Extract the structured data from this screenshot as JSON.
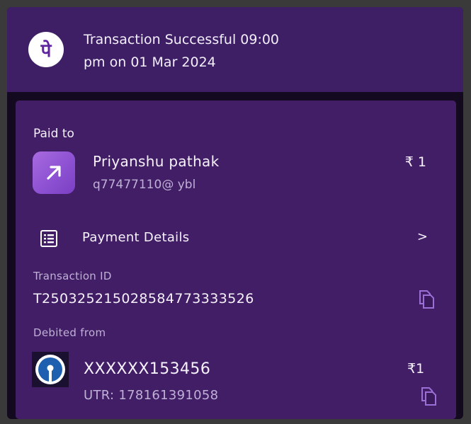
{
  "header": {
    "logo_glyph": "पे",
    "title": "Transaction Successful 09:00 pm on 01 Mar 2024"
  },
  "card": {
    "paid_to_label": "Paid to",
    "merchant": {
      "name": "Priyanshu pathak",
      "upi_id": "q77477110@ ybl",
      "amount": "₹ 1",
      "icon": "arrow-up-right-icon"
    },
    "payment_details": {
      "label": "Payment Details",
      "chevron": ">",
      "icon": "list-icon"
    },
    "transaction": {
      "label": "Transaction ID",
      "id": "T2503252150285847733335​26",
      "copy_icon": "copy-icon"
    },
    "debited": {
      "label": "Debited from",
      "account": "XXXXXX153456",
      "amount": "₹1",
      "utr": "UTR: 178161391058",
      "bank_icon": "sbi-logo-icon",
      "copy_icon": "copy-icon"
    }
  },
  "colors": {
    "header_bg": "#3e1f66",
    "card_bg": "#421e66",
    "muted_text": "#bfb0d6",
    "brand_purple": "#5f259f"
  }
}
